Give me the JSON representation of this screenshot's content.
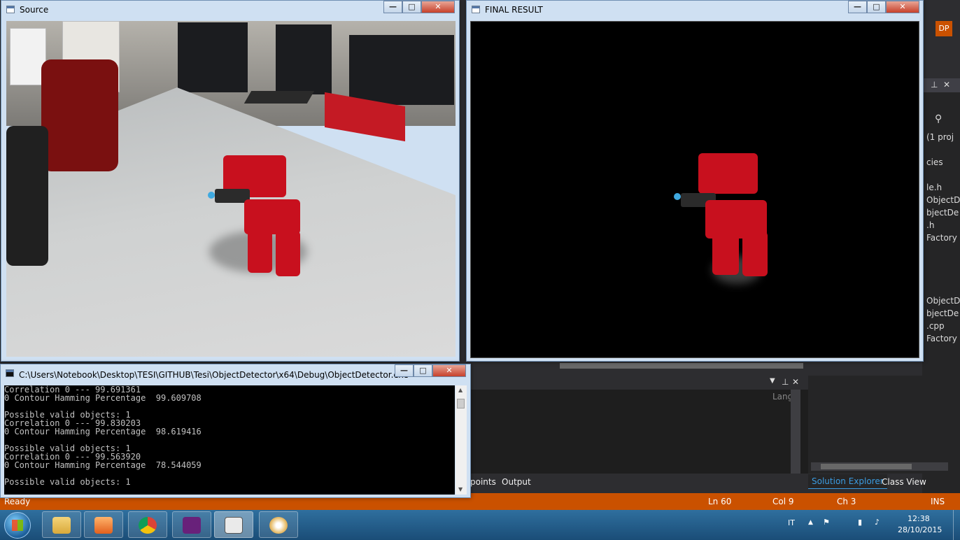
{
  "vs_background": {
    "user_initials": "DP",
    "right_tree_items": [
      "(1 proj",
      "cies",
      "le.h",
      "ObjectD",
      "bjectDe",
      ".h",
      "Factory",
      "ObjectD",
      "bjectDe",
      ".cpp",
      "Factory"
    ],
    "bottom_panel_header": "Lang",
    "bottom_tabs": [
      "points",
      "Output"
    ],
    "solution_tabs": [
      "Solution Explorer",
      "Class View"
    ],
    "status": {
      "ready": "Ready",
      "line": "Ln 60",
      "col": "Col 9",
      "ch": "Ch 3",
      "mode": "INS"
    },
    "accent_color": "#ca5100"
  },
  "windows": {
    "source": {
      "title": "Source"
    },
    "final": {
      "title": "FINAL RESULT"
    },
    "console": {
      "title": "C:\\Users\\Notebook\\Desktop\\TESI\\GITHUB\\Tesi\\ObjectDetector\\x64\\Debug\\ObjectDetector.exe",
      "lines": [
        "Correlation 0 --- 99.691361",
        "0 Contour Hamming Percentage  99.609708",
        "",
        "Possible valid objects: 1",
        "Correlation 0 --- 99.830203",
        "0 Contour Hamming Percentage  98.619416",
        "",
        "Possible valid objects: 1",
        "Correlation 0 --- 99.563920",
        "0 Contour Hamming Percentage  78.544059",
        "",
        "Possible valid objects: 1"
      ]
    },
    "controls": {
      "minimize": "—",
      "maximize": "□",
      "close": "✕"
    }
  },
  "taskbar": {
    "apps": [
      "windows-explorer-icon",
      "media-player-icon",
      "chrome-icon",
      "visual-studio-icon",
      "console-app-icon",
      "paint-icon"
    ],
    "language": "IT",
    "time": "12:38",
    "date": "28/10/2015"
  }
}
